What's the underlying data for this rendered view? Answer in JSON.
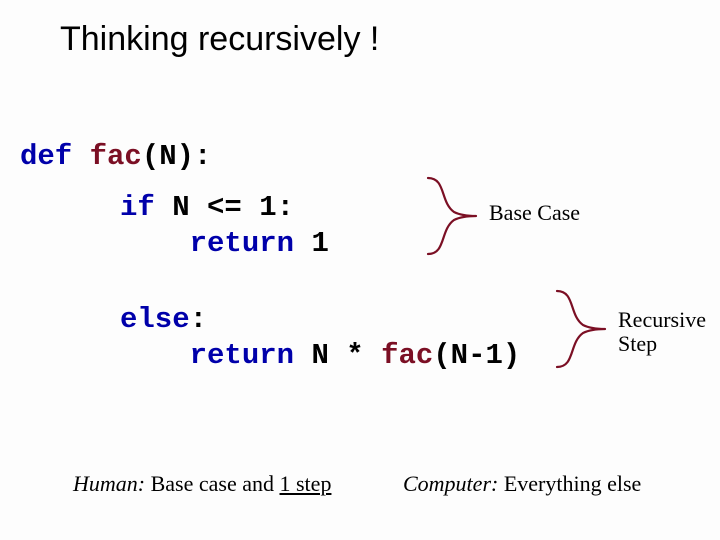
{
  "title": "Thinking recursively !",
  "code": {
    "def": "def",
    "fac": "fac",
    "def_rest": "(N):",
    "if_kw": "if",
    "if_cond": " N <= 1:",
    "return_kw": "return",
    "return_1_val": " 1",
    "else_kw": "else",
    "else_colon": ":",
    "ret_expr_pre": " N * ",
    "ret_expr_post": "(N-1)"
  },
  "annotations": {
    "base": "Base Case",
    "recursive_l1": "Recursive",
    "recursive_l2": "Step"
  },
  "bottom": {
    "human_prefix": "Human:",
    "human_mid": " Base case and ",
    "human_step": "1 step",
    "computer_prefix": "Computer:",
    "computer_rest": " Everything else"
  }
}
